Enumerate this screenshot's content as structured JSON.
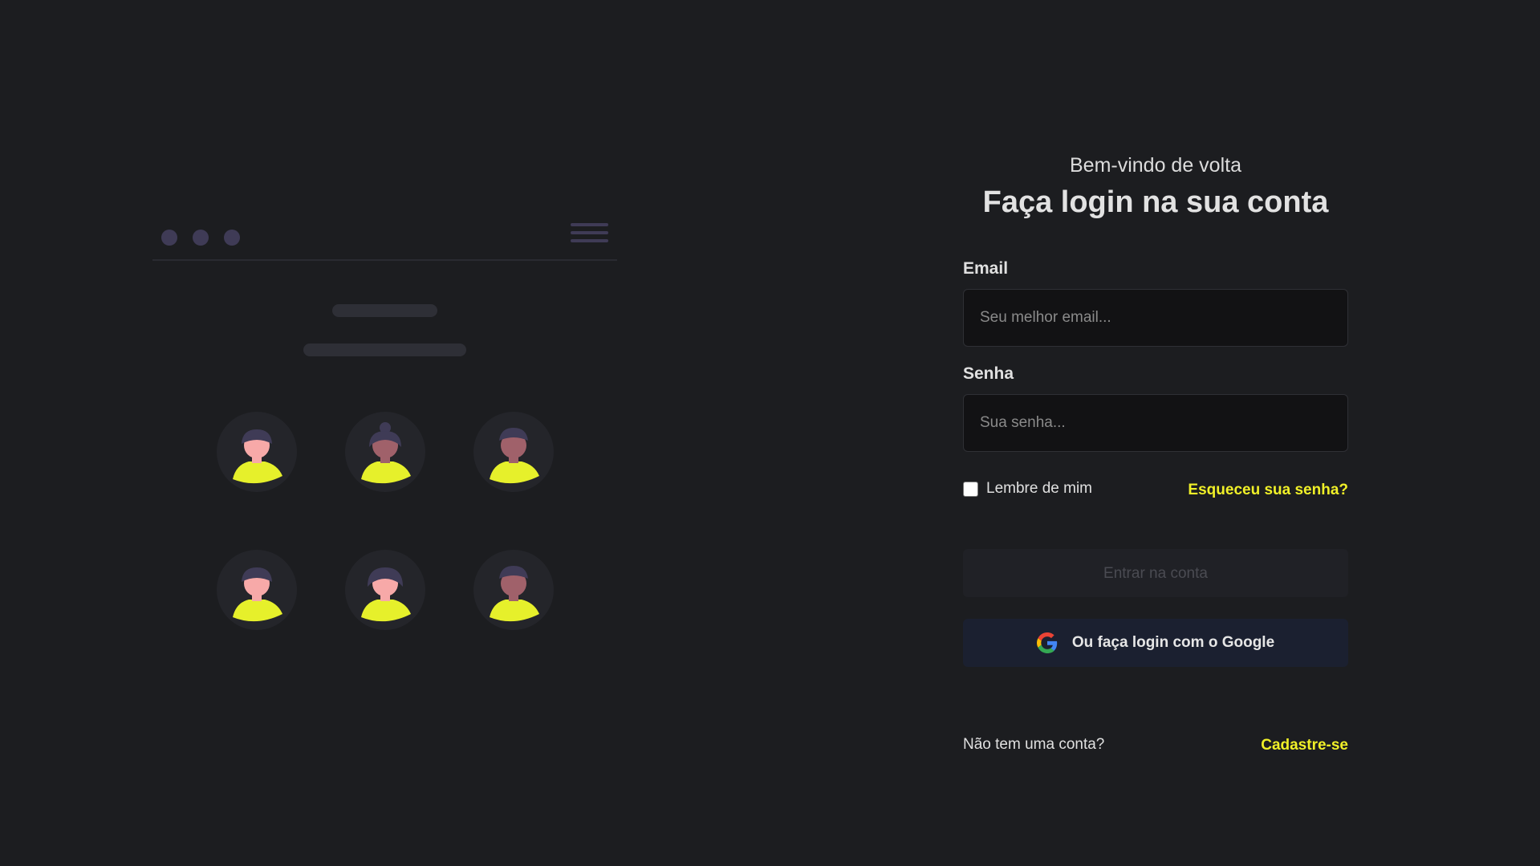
{
  "illustration": {
    "dots": 3,
    "avatars": [
      {
        "skin": "#f7a9a8",
        "hair": "#3f3b56",
        "style": "m1"
      },
      {
        "skin": "#a0616a",
        "hair": "#3f3b56",
        "style": "bun"
      },
      {
        "skin": "#a0616a",
        "hair": "#3f3b56",
        "style": "m2"
      },
      {
        "skin": "#f7a9a8",
        "hair": "#3f3b56",
        "style": "m1"
      },
      {
        "skin": "#f7a9a8",
        "hair": "#3f3b56",
        "style": "f2"
      },
      {
        "skin": "#a0616a",
        "hair": "#3f3b56",
        "style": "m2"
      }
    ],
    "accent": "#e6f02b"
  },
  "login": {
    "welcome": "Bem-vindo de volta",
    "title": "Faça login na sua conta",
    "email_label": "Email",
    "email_placeholder": "Seu melhor email...",
    "password_label": "Senha",
    "password_placeholder": "Sua senha...",
    "remember_label": "Lembre de mim",
    "forgot_link": "Esqueceu sua senha?",
    "submit_button": "Entrar na conta",
    "google_button": "Ou faça login com o Google",
    "no_account": "Não tem uma conta?",
    "signup_link": "Cadastre-se"
  },
  "colors": {
    "background": "#1c1d20",
    "accent": "#f0f028",
    "input_bg": "#121214",
    "google_btn_bg": "#1b2030"
  }
}
